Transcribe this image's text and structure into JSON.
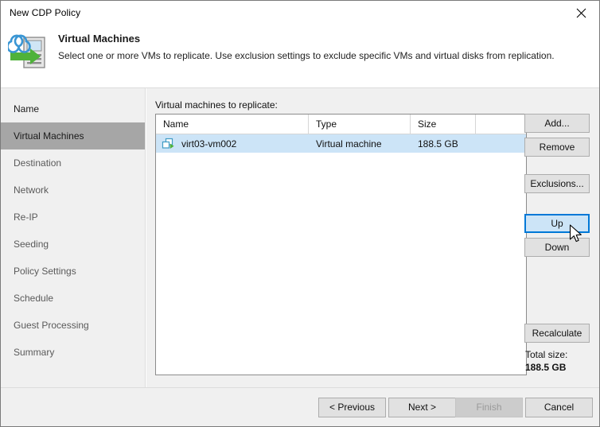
{
  "window": {
    "title": "New CDP Policy",
    "close_icon": "close-icon"
  },
  "header": {
    "icon": "cdp-replication-icon",
    "title": "Virtual Machines",
    "subtitle": "Select one or more VMs to replicate. Use exclusion settings to exclude specific VMs and virtual disks from replication."
  },
  "sidebar": {
    "items": [
      {
        "label": "Name",
        "state": "visited"
      },
      {
        "label": "Virtual Machines",
        "state": "active"
      },
      {
        "label": "Destination",
        "state": "normal"
      },
      {
        "label": "Network",
        "state": "normal"
      },
      {
        "label": "Re-IP",
        "state": "normal"
      },
      {
        "label": "Seeding",
        "state": "normal"
      },
      {
        "label": "Policy Settings",
        "state": "normal"
      },
      {
        "label": "Schedule",
        "state": "normal"
      },
      {
        "label": "Guest Processing",
        "state": "normal"
      },
      {
        "label": "Summary",
        "state": "normal"
      }
    ]
  },
  "main": {
    "list_label": "Virtual machines to replicate:",
    "table": {
      "columns": [
        "Name",
        "Type",
        "Size"
      ],
      "rows": [
        {
          "icon": "virtual-machine-icon",
          "name": "virt03-vm002",
          "type": "Virtual machine",
          "size": "188.5 GB",
          "selected": true
        }
      ]
    },
    "buttons": {
      "add": "Add...",
      "remove": "Remove",
      "exclusions": "Exclusions...",
      "up": "Up",
      "down": "Down",
      "recalculate": "Recalculate"
    },
    "total": {
      "label": "Total size:",
      "value": "188.5 GB"
    }
  },
  "footer": {
    "previous": "< Previous",
    "next": "Next >",
    "finish": "Finish",
    "cancel": "Cancel"
  },
  "colors": {
    "accent": "#0078d7",
    "selection": "#cce4f7",
    "sidebar_active": "#a6a6a6",
    "surface": "#f0f0f0"
  }
}
